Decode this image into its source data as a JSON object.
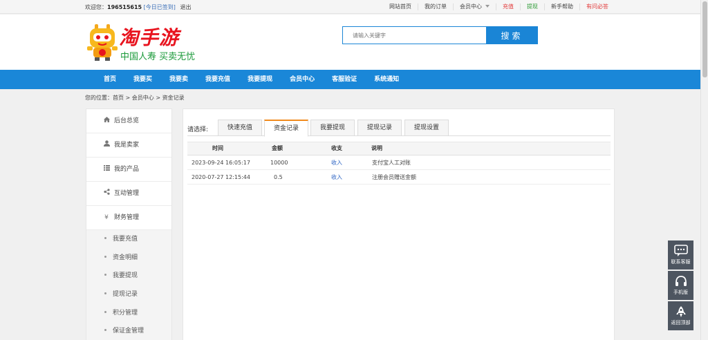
{
  "topbar": {
    "welcome": "欢迎您：",
    "username": "196515615",
    "signed": "[今日已签到]",
    "logout": "退出",
    "links": {
      "home": "网站首页",
      "orders": "我的订单",
      "member": "会员中心",
      "recharge": "充值",
      "withdraw": "提现",
      "help": "新手帮助",
      "qa": "有问必答"
    }
  },
  "header": {
    "brand": "淘手游",
    "slogan": "中国人寿 买卖无忧",
    "search_placeholder": "请输入关键字",
    "search_button": "搜索"
  },
  "nav": [
    "首页",
    "我要买",
    "我要卖",
    "我要充值",
    "我要提现",
    "会员中心",
    "客服验证",
    "系统通知"
  ],
  "breadcrumb": "您的位置：首页 > 会员中心 > 资金记录",
  "sidebar": {
    "items": [
      {
        "label": "后台总览",
        "icon": "home-icon"
      },
      {
        "label": "我是卖家",
        "icon": "user-icon"
      },
      {
        "label": "我的产品",
        "icon": "list-icon"
      },
      {
        "label": "互动管理",
        "icon": "share-icon"
      },
      {
        "label": "财务管理",
        "icon": "yen-icon"
      }
    ],
    "sub_items": [
      "我要充值",
      "资金明细",
      "我要提现",
      "提现记录",
      "积分管理",
      "保证金管理"
    ]
  },
  "main": {
    "select_label": "请选择:",
    "tabs": [
      "快速充值",
      "资金记录",
      "我要提现",
      "提现记录",
      "提现设置"
    ],
    "active_tab": 1,
    "columns": [
      "时间",
      "金额",
      "收支",
      "说明"
    ],
    "rows": [
      {
        "time": "2023-09-24 16:05:17",
        "amount": "10000",
        "type": "收入",
        "note": "支付宝人工对账"
      },
      {
        "time": "2020-07-27 12:15:44",
        "amount": "0.5",
        "type": "收入",
        "note": "注册会员赠送金额"
      }
    ]
  },
  "float_tools": {
    "service": "联系客服",
    "mobile": "手机版",
    "top": "返回顶部"
  },
  "colors": {
    "brand_blue": "#1a87d8",
    "brand_red": "#e8141f",
    "slogan_green": "#1b9a3a",
    "active_tab_orange": "#f08a1c",
    "income_blue": "#2f66c4"
  }
}
